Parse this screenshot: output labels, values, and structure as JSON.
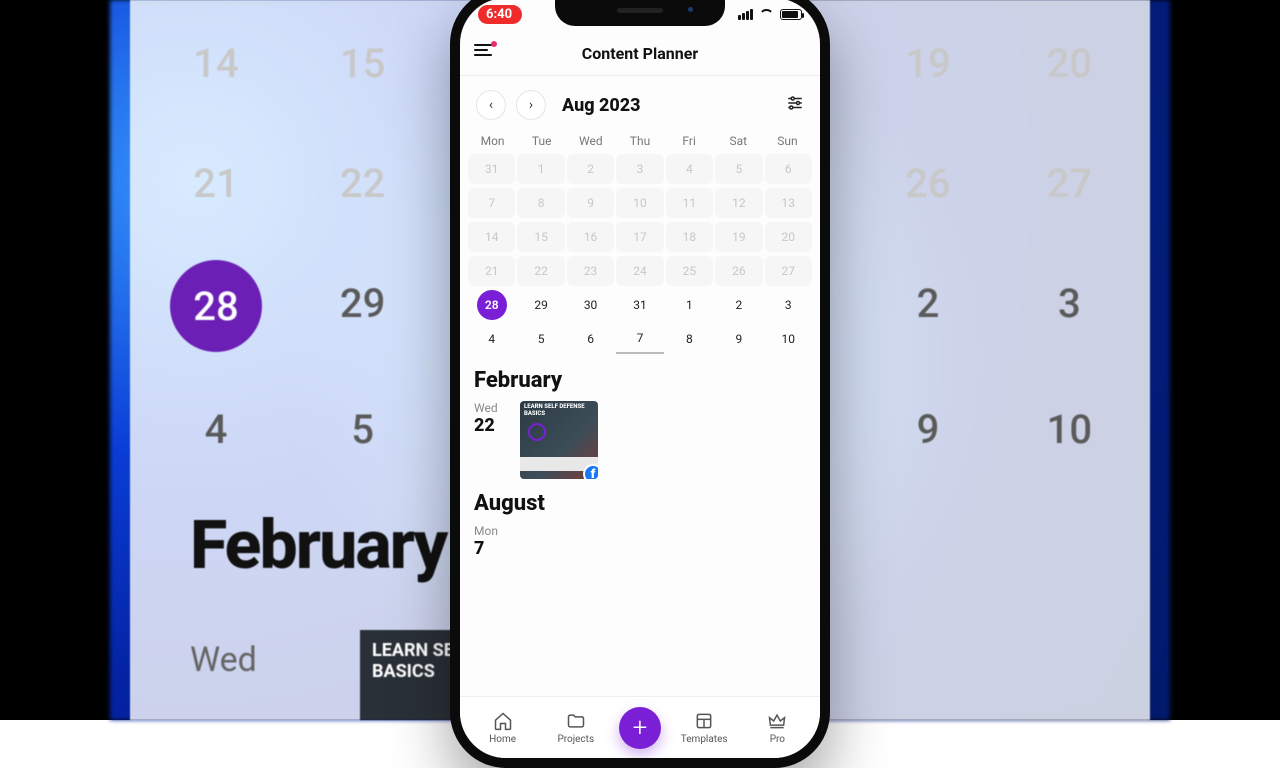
{
  "status_time": "6:40",
  "app_title": "Content Planner",
  "month_label": "Aug 2023",
  "dow": [
    "Mon",
    "Tue",
    "Wed",
    "Thu",
    "Fri",
    "Sat",
    "Sun"
  ],
  "weeks": [
    [
      {
        "n": "31",
        "fade": true
      },
      {
        "n": "1",
        "fade": true
      },
      {
        "n": "2",
        "fade": true
      },
      {
        "n": "3",
        "fade": true
      },
      {
        "n": "4",
        "fade": true
      },
      {
        "n": "5",
        "fade": true
      },
      {
        "n": "6",
        "fade": true
      }
    ],
    [
      {
        "n": "7",
        "fade": true
      },
      {
        "n": "8",
        "fade": true
      },
      {
        "n": "9",
        "fade": true
      },
      {
        "n": "10",
        "fade": true
      },
      {
        "n": "11",
        "fade": true
      },
      {
        "n": "12",
        "fade": true
      },
      {
        "n": "13",
        "fade": true
      }
    ],
    [
      {
        "n": "14",
        "fade": true
      },
      {
        "n": "15",
        "fade": true
      },
      {
        "n": "16",
        "fade": true
      },
      {
        "n": "17",
        "fade": true
      },
      {
        "n": "18",
        "fade": true
      },
      {
        "n": "19",
        "fade": true
      },
      {
        "n": "20",
        "fade": true
      }
    ],
    [
      {
        "n": "21",
        "fade": true
      },
      {
        "n": "22",
        "fade": true
      },
      {
        "n": "23",
        "fade": true
      },
      {
        "n": "24",
        "fade": true
      },
      {
        "n": "25",
        "fade": true
      },
      {
        "n": "26",
        "fade": true
      },
      {
        "n": "27",
        "fade": true
      }
    ],
    [
      {
        "n": "28",
        "sel": true
      },
      {
        "n": "29"
      },
      {
        "n": "30"
      },
      {
        "n": "31"
      },
      {
        "n": "1"
      },
      {
        "n": "2"
      },
      {
        "n": "3"
      }
    ],
    [
      {
        "n": "4"
      },
      {
        "n": "5"
      },
      {
        "n": "6"
      },
      {
        "n": "7",
        "today": true
      },
      {
        "n": "8"
      },
      {
        "n": "9"
      },
      {
        "n": "10"
      }
    ]
  ],
  "sections": [
    {
      "title": "February",
      "day_label": "Wed",
      "day_num": "22",
      "thumb_title": "LEARN SELF DEFENSE BASICS",
      "platform": "f"
    },
    {
      "title": "August",
      "day_label": "Mon",
      "day_num": "7"
    }
  ],
  "tabs": {
    "home": "Home",
    "projects": "Projects",
    "templates": "Templates",
    "pro": "Pro"
  },
  "ghost": {
    "row1": [
      "14",
      "15",
      "",
      "",
      "",
      "19",
      "20"
    ],
    "row2": [
      "21",
      "22",
      "",
      "",
      "",
      "26",
      "27"
    ],
    "row3": [
      "28",
      "29",
      "",
      "",
      "",
      "2",
      "3"
    ],
    "row4": [
      "4",
      "5",
      "",
      "",
      "",
      "9",
      "10"
    ],
    "heading": "February",
    "wed": "Wed",
    "thumb": "LEARN SELF DEFENSE BASICS"
  }
}
